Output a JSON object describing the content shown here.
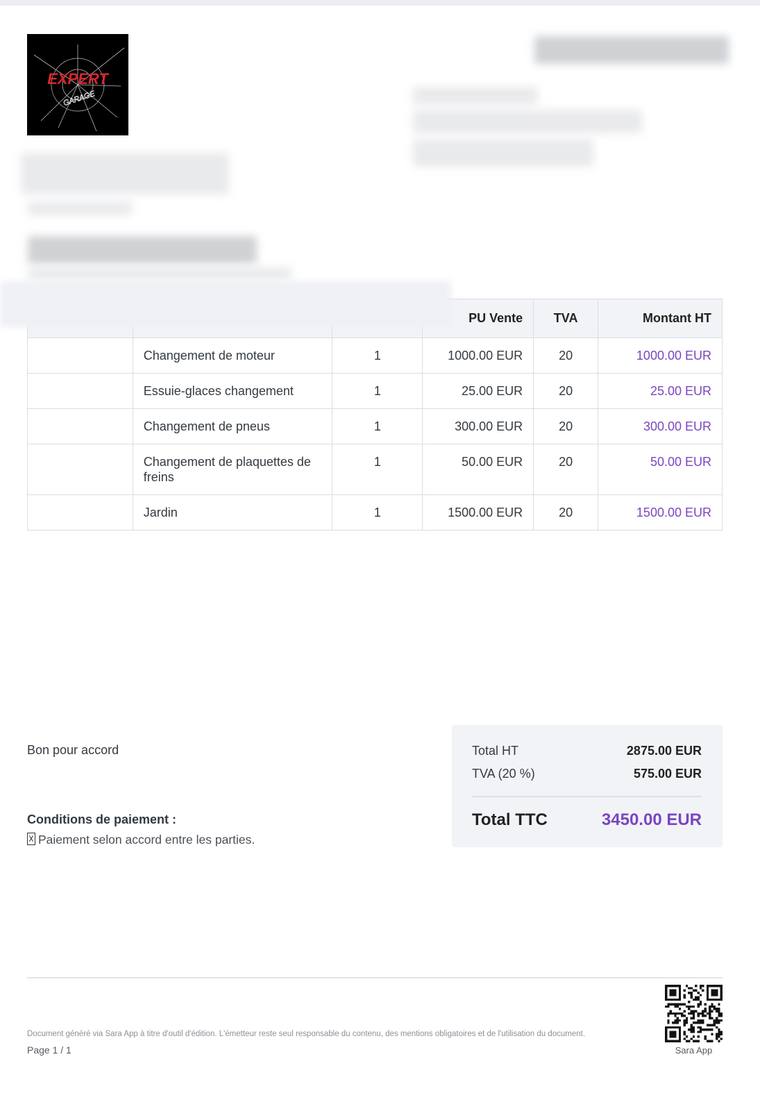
{
  "logo": {
    "brand": "EXPERT"
  },
  "table": {
    "headers": {
      "pu": "PU Vente",
      "tva": "TVA",
      "montant": "Montant HT"
    },
    "rows": [
      {
        "designation": "Changement de moteur",
        "qty": "1",
        "pu": "1000.00 EUR",
        "tva": "20",
        "montant": "1000.00 EUR"
      },
      {
        "designation": "Essuie-glaces changement",
        "qty": "1",
        "pu": "25.00 EUR",
        "tva": "20",
        "montant": "25.00 EUR"
      },
      {
        "designation": "Changement de pneus",
        "qty": "1",
        "pu": "300.00 EUR",
        "tva": "20",
        "montant": "300.00 EUR"
      },
      {
        "designation": "Changement de plaquettes de freins",
        "qty": "1",
        "pu": "50.00 EUR",
        "tva": "20",
        "montant": "50.00 EUR"
      },
      {
        "designation": "Jardin",
        "qty": "1",
        "pu": "1500.00 EUR",
        "tva": "20",
        "montant": "1500.00 EUR"
      }
    ]
  },
  "agreement": {
    "label": "Bon pour accord"
  },
  "conditions": {
    "title": "Conditions de paiement :",
    "text": "Paiement selon accord entre les parties."
  },
  "totals": {
    "ht_label": "Total HT",
    "ht_value": "2875.00 EUR",
    "tva_label": "TVA (20 %)",
    "tva_value": "575.00 EUR",
    "ttc_label": "Total TTC",
    "ttc_value": "3450.00 EUR"
  },
  "footer": {
    "note": "Document généré via Sara App à titre d'outil d'édition. L'émetteur reste seul responsable du contenu, des mentions obligatoires et de l'utilisation du document.",
    "page": "Page 1 / 1",
    "qr_label": "Sara App"
  },
  "colors": {
    "accent": "#7b45c0",
    "table_header_bg": "#f1f3f6",
    "border": "#d9dde2"
  }
}
